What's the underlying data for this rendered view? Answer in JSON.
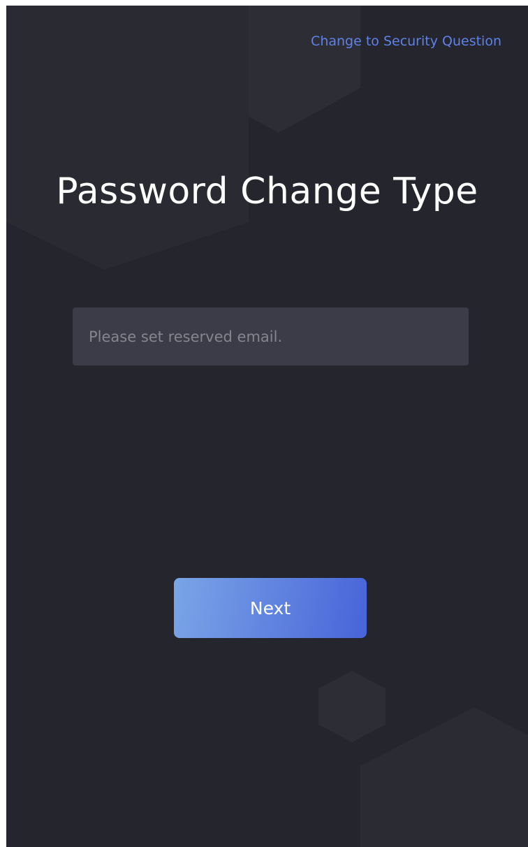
{
  "header": {
    "security_question_link": "Change to Security Question"
  },
  "main": {
    "title": "Password Change Type",
    "email_input": {
      "placeholder": "Please set reserved email.",
      "value": ""
    },
    "next_button": "Next"
  },
  "colors": {
    "background": "#25252d",
    "input_background": "#3c3c48",
    "link": "#5f82e8",
    "button_gradient_start": "#7aa5e7",
    "button_gradient_end": "#4864d9"
  }
}
